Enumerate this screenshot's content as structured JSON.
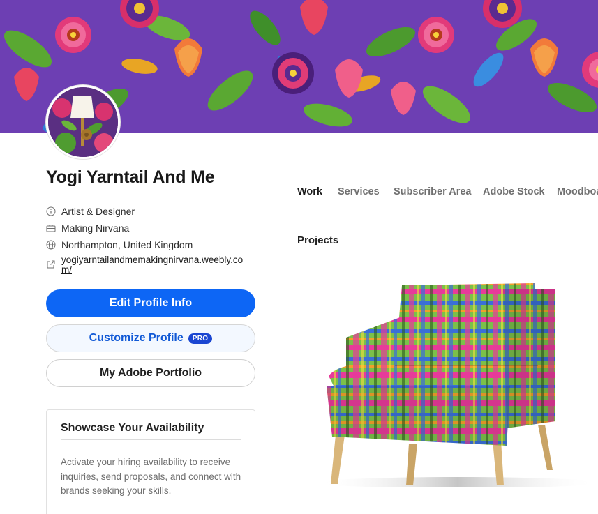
{
  "profile": {
    "name": "Yogi Yarntail And Me",
    "occupation": "Artist & Designer",
    "company": "Making Nirvana",
    "location": "Northampton, United Kingdom",
    "website": "yogiyarntailandmemakingnirvana.weebly.com/"
  },
  "buttons": {
    "edit_profile": "Edit Profile Info",
    "customize_profile": "Customize Profile",
    "pro_badge": "PRO",
    "portfolio": "My Adobe Portfolio"
  },
  "availability": {
    "title": "Showcase Your Availability",
    "description": "Activate your hiring availability to receive inquiries, send proposals, and connect with brands seeking your skills."
  },
  "tabs": [
    {
      "label": "Work",
      "active": true
    },
    {
      "label": "Services",
      "active": false
    },
    {
      "label": "Subscriber Area",
      "active": false
    },
    {
      "label": "Adobe Stock",
      "active": false
    },
    {
      "label": "Moodboards",
      "active": false
    }
  ],
  "projects": {
    "heading": "Projects"
  },
  "icons": {
    "occupation": "info-circle-icon",
    "company": "briefcase-icon",
    "location": "globe-icon",
    "website": "external-link-icon"
  },
  "colors": {
    "banner_background": "#6b3fb0",
    "primary_button": "#0d66f5",
    "pro_badge": "#1a46d2",
    "customize_text": "#1159d6"
  }
}
